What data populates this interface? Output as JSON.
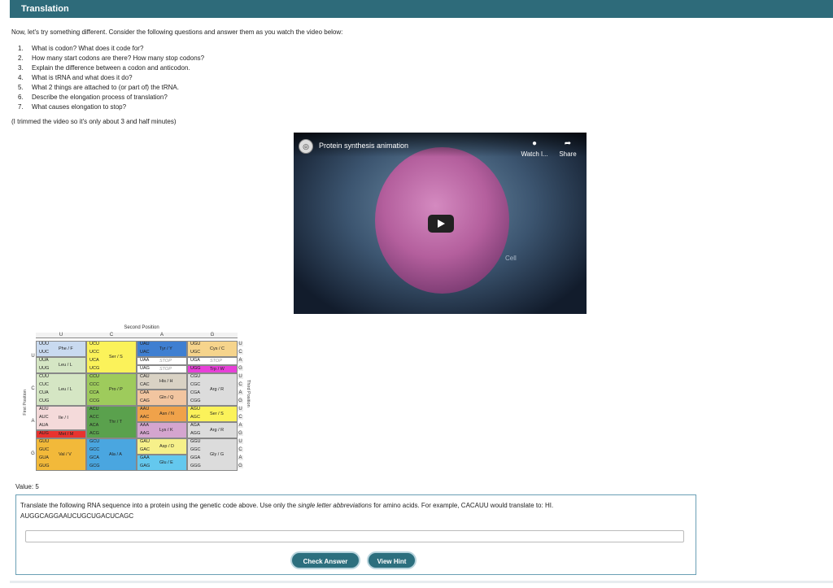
{
  "header": {
    "title": "Translation"
  },
  "intro": "Now, let's try something different. Consider the following questions and answer them as you watch the video below:",
  "questions": [
    {
      "num": "1.",
      "text": "What is codon? What does it code for?"
    },
    {
      "num": "2.",
      "text": "How many start codons are there? How many stop codons?"
    },
    {
      "num": "3.",
      "text": "Explain the difference between a codon and anticodon."
    },
    {
      "num": "4.",
      "text": "What is tRNA and what does it do?"
    },
    {
      "num": "5.",
      "text": "What 2 things are attached to (or part of) the tRNA."
    },
    {
      "num": "6.",
      "text": "Describe the elongation process of translation?"
    },
    {
      "num": "7.",
      "text": "What causes elongation to stop?"
    }
  ],
  "note": "(I trimmed the video so it's only about 3 and half minutes)",
  "video": {
    "title": "Protein synthesis animation",
    "watch_label": "Watch l...",
    "share_label": "Share",
    "cell_label": "Cell"
  },
  "codon_table": {
    "second_position": "Second Position",
    "first_position": "First Position",
    "third_position": "Third Position",
    "bases": [
      "U",
      "C",
      "A",
      "G"
    ],
    "third_bases": [
      "U",
      "C",
      "A",
      "G"
    ],
    "columns": [
      {
        "codons": [
          "UUU",
          "UUC",
          "UUA",
          "UUG",
          "CUU",
          "CUC",
          "CUA",
          "CUG",
          "AUU",
          "AUC",
          "AUA",
          "AUG",
          "GUU",
          "GUC",
          "GUA",
          "GUG"
        ],
        "aa": [
          {
            "label": "Phe / F",
            "row": 0,
            "span": 2,
            "color": "#c9daf0"
          },
          {
            "label": "Leu / L",
            "row": 2,
            "span": 2,
            "color": "#d5e6c4"
          },
          {
            "label": "Leu / L",
            "row": 4,
            "span": 4,
            "color": "#d5e6c4"
          },
          {
            "label": "Ile / I",
            "row": 8,
            "span": 3,
            "color": "#f4dada"
          },
          {
            "label": "Met / M",
            "row": 11,
            "span": 1,
            "color": "#e8332f"
          },
          {
            "label": "Val / V",
            "row": 12,
            "span": 4,
            "color": "#f2b93a"
          }
        ]
      },
      {
        "codons": [
          "UCU",
          "UCC",
          "UCA",
          "UCG",
          "CCU",
          "CCC",
          "CCA",
          "CCG",
          "ACU",
          "ACC",
          "ACA",
          "ACG",
          "GCU",
          "GCC",
          "GCA",
          "GCG"
        ],
        "aa": [
          {
            "label": "Ser / S",
            "row": 0,
            "span": 4,
            "color": "#fbf25a"
          },
          {
            "label": "Pro / P",
            "row": 4,
            "span": 4,
            "color": "#9ecb5c"
          },
          {
            "label": "Thr / T",
            "row": 8,
            "span": 4,
            "color": "#5aa14d"
          },
          {
            "label": "Ala / A",
            "row": 12,
            "span": 4,
            "color": "#4aa6e0"
          }
        ]
      },
      {
        "codons": [
          "UAU",
          "UAC",
          "UAA",
          "UAG",
          "CAU",
          "CAC",
          "CAA",
          "CAG",
          "AAU",
          "AAC",
          "AAA",
          "AAG",
          "GAU",
          "GAC",
          "GAA",
          "GAG"
        ],
        "aa": [
          {
            "label": "Tyr / Y",
            "row": 0,
            "span": 2,
            "color": "#3f7fd1"
          },
          {
            "label": "STOP",
            "row": 2,
            "span": 1,
            "color": "#ffffff"
          },
          {
            "label": "STOP",
            "row": 3,
            "span": 1,
            "color": "#ffffff"
          },
          {
            "label": "His / H",
            "row": 4,
            "span": 2,
            "color": "#d9d2c4"
          },
          {
            "label": "Gln / Q",
            "row": 6,
            "span": 2,
            "color": "#f2c5a0"
          },
          {
            "label": "Asn / N",
            "row": 8,
            "span": 2,
            "color": "#f0a24a"
          },
          {
            "label": "Lys / K",
            "row": 10,
            "span": 2,
            "color": "#d4a5cf"
          },
          {
            "label": "Asp / D",
            "row": 12,
            "span": 2,
            "color": "#f6f08a"
          },
          {
            "label": "Glu / E",
            "row": 14,
            "span": 2,
            "color": "#64c8ee"
          }
        ]
      },
      {
        "codons": [
          "UGU",
          "UGC",
          "UGA",
          "UGG",
          "CGU",
          "CGC",
          "CGA",
          "CGG",
          "AGU",
          "AGC",
          "AGA",
          "AGG",
          "GGU",
          "GGC",
          "GGA",
          "GGG"
        ],
        "aa": [
          {
            "label": "Cys / C",
            "row": 0,
            "span": 2,
            "color": "#f6d48c"
          },
          {
            "label": "STOP",
            "row": 2,
            "span": 1,
            "color": "#ffffff"
          },
          {
            "label": "Trp / W",
            "row": 3,
            "span": 1,
            "color": "#e73fd8"
          },
          {
            "label": "Arg / R",
            "row": 4,
            "span": 4,
            "color": "#dcdcdc"
          },
          {
            "label": "Ser / S",
            "row": 8,
            "span": 2,
            "color": "#fbf25a"
          },
          {
            "label": "Arg / R",
            "row": 10,
            "span": 2,
            "color": "#dcdcdc"
          },
          {
            "label": "Gly / G",
            "row": 12,
            "span": 4,
            "color": "#dcdcdc"
          }
        ]
      }
    ]
  },
  "value_label": "Value: 5",
  "question": {
    "prompt_start": "Translate the following RNA sequence into a protein using the genetic code above. Use only the ",
    "prompt_emphasis": "single letter abbreviations",
    "prompt_end": " for amino acids. For example, CACAUU would translate to: HI.",
    "sequence": "AUGGCAGGAAUCUGCUGACUCAGC",
    "answer_value": "",
    "check_label": "Check Answer",
    "hint_label": "View Hint"
  }
}
